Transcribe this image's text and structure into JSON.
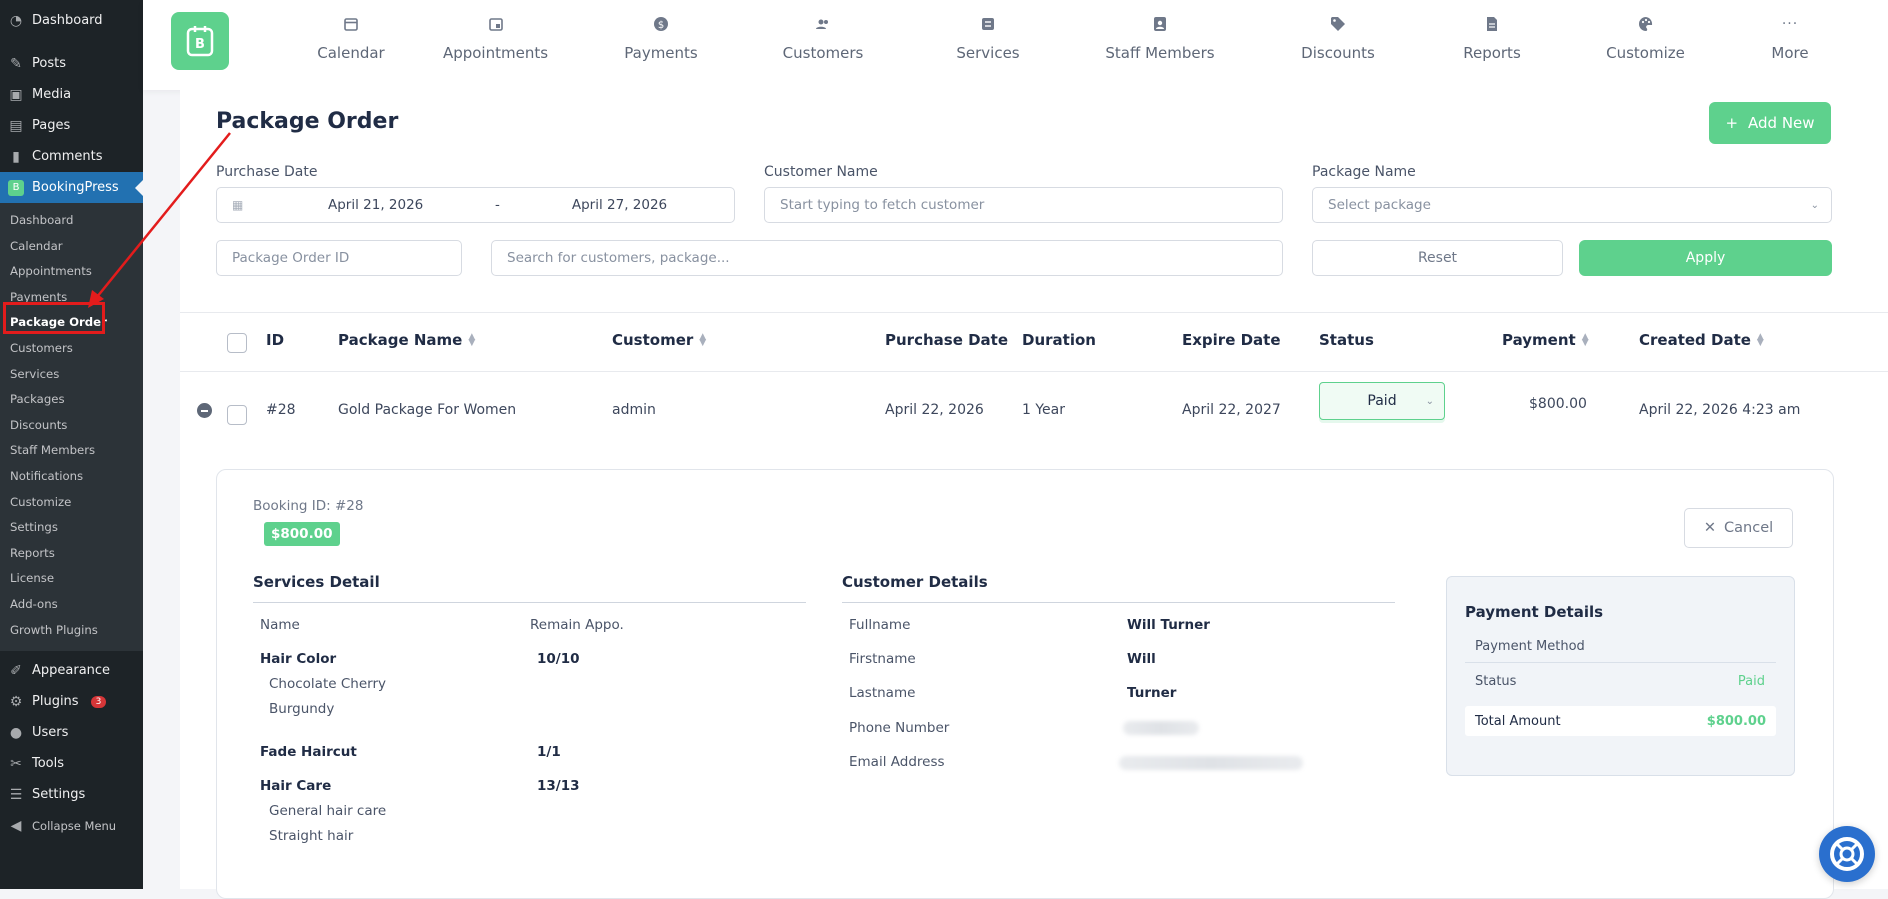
{
  "wp_menu": {
    "top": [
      {
        "label": "Dashboard",
        "icon": "dashboard-icon"
      },
      {
        "label": "Posts",
        "icon": "pin-icon"
      },
      {
        "label": "Media",
        "icon": "media-icon"
      },
      {
        "label": "Pages",
        "icon": "pages-icon"
      },
      {
        "label": "Comments",
        "icon": "comment-icon"
      },
      {
        "label": "BookingPress",
        "icon": "bookingpress-icon"
      }
    ],
    "sub": [
      "Dashboard",
      "Calendar",
      "Appointments",
      "Payments",
      "Package Order",
      "Customers",
      "Services",
      "Packages",
      "Discounts",
      "Staff Members",
      "Notifications",
      "Customize",
      "Settings",
      "Reports",
      "License",
      "Add-ons",
      "Growth Plugins"
    ],
    "bottom": [
      {
        "label": "Appearance",
        "icon": "brush-icon"
      },
      {
        "label": "Plugins",
        "icon": "plugin-icon",
        "badge": "3"
      },
      {
        "label": "Users",
        "icon": "user-icon"
      },
      {
        "label": "Tools",
        "icon": "wrench-icon"
      },
      {
        "label": "Settings",
        "icon": "settings-icon"
      },
      {
        "label": "Collapse Menu",
        "icon": "collapse-icon"
      }
    ]
  },
  "topnav": [
    {
      "label": "Calendar",
      "icon": "calendar-icon"
    },
    {
      "label": "Appointments",
      "icon": "appointments-icon"
    },
    {
      "label": "Payments",
      "icon": "dollar-icon"
    },
    {
      "label": "Customers",
      "icon": "customers-icon"
    },
    {
      "label": "Services",
      "icon": "services-icon"
    },
    {
      "label": "Staff Members",
      "icon": "staff-icon"
    },
    {
      "label": "Discounts",
      "icon": "tag-icon"
    },
    {
      "label": "Reports",
      "icon": "reports-icon"
    },
    {
      "label": "Customize",
      "icon": "palette-icon"
    },
    {
      "label": "More",
      "icon": "more-icon"
    }
  ],
  "page": {
    "title": "Package Order",
    "add_new": "Add New"
  },
  "filters": {
    "purchase_date_label": "Purchase Date",
    "date_from": "April 21, 2026",
    "date_sep": "-",
    "date_to": "April 27, 2026",
    "customer_label": "Customer Name",
    "customer_placeholder": "Start typing to fetch customer",
    "package_label": "Package Name",
    "package_placeholder": "Select package",
    "order_id_placeholder": "Package Order ID",
    "search_placeholder": "Search for customers, package...",
    "reset": "Reset",
    "apply": "Apply"
  },
  "table": {
    "headers": [
      "ID",
      "Package Name",
      "Customer",
      "Purchase Date",
      "Duration",
      "Expire Date",
      "Status",
      "Payment",
      "Created Date"
    ],
    "row": {
      "id": "#28",
      "package": "Gold Package For Women",
      "customer": "admin",
      "purchase_date": "April 22, 2026",
      "duration": "1 Year",
      "expire_date": "April 22, 2027",
      "status": "Paid",
      "payment": "$800.00",
      "created": "April 22, 2026 4:23 am"
    }
  },
  "detail": {
    "booking_id": "Booking ID: #28",
    "amount": "$800.00",
    "cancel": "Cancel",
    "services_title": "Services Detail",
    "col_name": "Name",
    "col_remain": "Remain Appo.",
    "services": [
      {
        "name": "Hair Color",
        "remain": "10/10",
        "subs": [
          "Chocolate Cherry",
          "Burgundy"
        ]
      },
      {
        "name": "Fade Haircut",
        "remain": "1/1",
        "subs": []
      },
      {
        "name": "Hair Care",
        "remain": "13/13",
        "subs": [
          "General hair care",
          "Straight hair"
        ]
      }
    ],
    "customer_title": "Customer Details",
    "customer_fields": [
      {
        "label": "Fullname",
        "value": "Will Turner"
      },
      {
        "label": "Firstname",
        "value": "Will"
      },
      {
        "label": "Lastname",
        "value": "Turner"
      },
      {
        "label": "Phone Number",
        "value": ""
      },
      {
        "label": "Email Address",
        "value": ""
      }
    ],
    "payment_title": "Payment Details",
    "payment_method_label": "Payment Method",
    "status_label": "Status",
    "status_value": "Paid",
    "total_label": "Total Amount",
    "total_value": "$800.00"
  },
  "colors": {
    "accent": "#5ed18d",
    "wp_sidebar": "#1d2327",
    "wp_active": "#2271b1",
    "annotation": "#e31c1c"
  }
}
